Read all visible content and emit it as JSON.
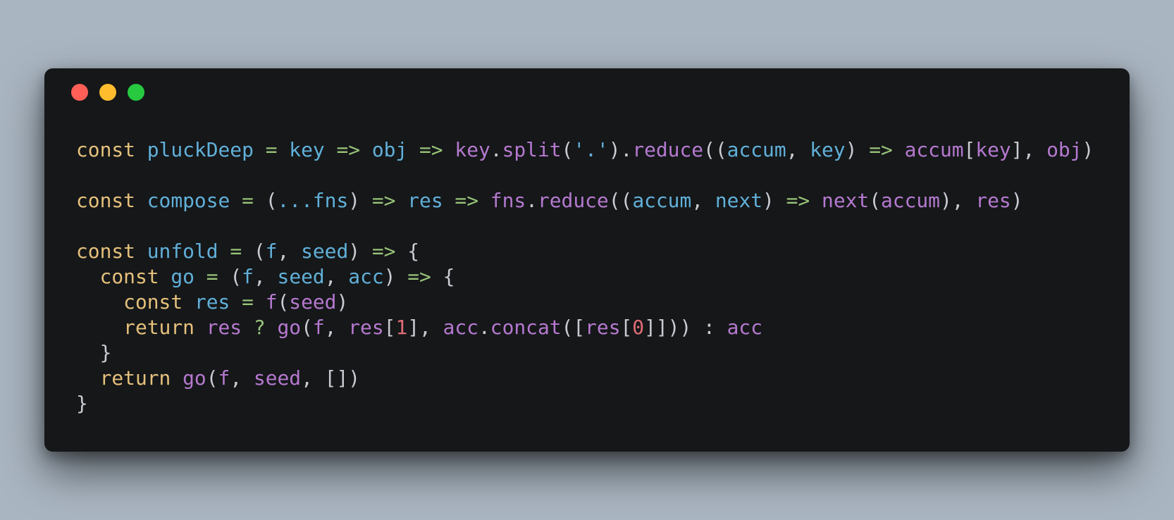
{
  "window": {
    "controls": {
      "close_color": "#ff5f56",
      "minimize_color": "#ffbd2e",
      "maximize_color": "#27c93f"
    },
    "colors": {
      "background": "#a9b5c1",
      "editor": "#151719",
      "keyword": "#e5c07b",
      "identifier": "#61b0d9",
      "call": "#b579cf",
      "operator": "#98c379",
      "punctuation": "#c8ccd2",
      "number": "#e06c75"
    }
  },
  "code": {
    "lines": [
      [
        [
          "k",
          "const"
        ],
        [
          "w",
          " "
        ],
        [
          "b",
          "pluckDeep"
        ],
        [
          "w",
          " "
        ],
        [
          "g",
          "="
        ],
        [
          "w",
          " "
        ],
        [
          "b",
          "key"
        ],
        [
          "w",
          " "
        ],
        [
          "g",
          "=>"
        ],
        [
          "w",
          " "
        ],
        [
          "b",
          "obj"
        ],
        [
          "w",
          " "
        ],
        [
          "g",
          "=>"
        ],
        [
          "w",
          " "
        ],
        [
          "p",
          "key"
        ],
        [
          "w",
          "."
        ],
        [
          "p",
          "split"
        ],
        [
          "w",
          "("
        ],
        [
          "b",
          "'.'"
        ],
        [
          "w",
          ")."
        ],
        [
          "p",
          "reduce"
        ],
        [
          "w",
          "(("
        ],
        [
          "b",
          "accum"
        ],
        [
          "w",
          ", "
        ],
        [
          "b",
          "key"
        ],
        [
          "w",
          ") "
        ],
        [
          "g",
          "=>"
        ],
        [
          "w",
          " "
        ],
        [
          "p",
          "accum"
        ],
        [
          "w",
          "["
        ],
        [
          "p",
          "key"
        ],
        [
          "w",
          "], "
        ],
        [
          "p",
          "obj"
        ],
        [
          "w",
          ")"
        ]
      ],
      [],
      [
        [
          "k",
          "const"
        ],
        [
          "w",
          " "
        ],
        [
          "b",
          "compose"
        ],
        [
          "w",
          " "
        ],
        [
          "g",
          "="
        ],
        [
          "w",
          " ("
        ],
        [
          "b",
          "...fns"
        ],
        [
          "w",
          ") "
        ],
        [
          "g",
          "=>"
        ],
        [
          "w",
          " "
        ],
        [
          "b",
          "res"
        ],
        [
          "w",
          " "
        ],
        [
          "g",
          "=>"
        ],
        [
          "w",
          " "
        ],
        [
          "p",
          "fns"
        ],
        [
          "w",
          "."
        ],
        [
          "p",
          "reduce"
        ],
        [
          "w",
          "(("
        ],
        [
          "b",
          "accum"
        ],
        [
          "w",
          ", "
        ],
        [
          "b",
          "next"
        ],
        [
          "w",
          ") "
        ],
        [
          "g",
          "=>"
        ],
        [
          "w",
          " "
        ],
        [
          "p",
          "next"
        ],
        [
          "w",
          "("
        ],
        [
          "p",
          "accum"
        ],
        [
          "w",
          "), "
        ],
        [
          "p",
          "res"
        ],
        [
          "w",
          ")"
        ]
      ],
      [],
      [
        [
          "k",
          "const"
        ],
        [
          "w",
          " "
        ],
        [
          "b",
          "unfold"
        ],
        [
          "w",
          " "
        ],
        [
          "g",
          "="
        ],
        [
          "w",
          " ("
        ],
        [
          "b",
          "f"
        ],
        [
          "w",
          ", "
        ],
        [
          "b",
          "seed"
        ],
        [
          "w",
          ") "
        ],
        [
          "g",
          "=>"
        ],
        [
          "w",
          " {"
        ]
      ],
      [
        [
          "w",
          "  "
        ],
        [
          "k",
          "const"
        ],
        [
          "w",
          " "
        ],
        [
          "b",
          "go"
        ],
        [
          "w",
          " "
        ],
        [
          "g",
          "="
        ],
        [
          "w",
          " ("
        ],
        [
          "b",
          "f"
        ],
        [
          "w",
          ", "
        ],
        [
          "b",
          "seed"
        ],
        [
          "w",
          ", "
        ],
        [
          "b",
          "acc"
        ],
        [
          "w",
          ") "
        ],
        [
          "g",
          "=>"
        ],
        [
          "w",
          " {"
        ]
      ],
      [
        [
          "w",
          "    "
        ],
        [
          "k",
          "const"
        ],
        [
          "w",
          " "
        ],
        [
          "b",
          "res"
        ],
        [
          "w",
          " "
        ],
        [
          "g",
          "="
        ],
        [
          "w",
          " "
        ],
        [
          "p",
          "f"
        ],
        [
          "w",
          "("
        ],
        [
          "p",
          "seed"
        ],
        [
          "w",
          ")"
        ]
      ],
      [
        [
          "w",
          "    "
        ],
        [
          "k",
          "return"
        ],
        [
          "w",
          " "
        ],
        [
          "p",
          "res"
        ],
        [
          "w",
          " "
        ],
        [
          "g",
          "?"
        ],
        [
          "w",
          " "
        ],
        [
          "p",
          "go"
        ],
        [
          "w",
          "("
        ],
        [
          "p",
          "f"
        ],
        [
          "w",
          ", "
        ],
        [
          "p",
          "res"
        ],
        [
          "w",
          "["
        ],
        [
          "r",
          "1"
        ],
        [
          "w",
          "], "
        ],
        [
          "p",
          "acc"
        ],
        [
          "w",
          "."
        ],
        [
          "p",
          "concat"
        ],
        [
          "w",
          "(["
        ],
        [
          "p",
          "res"
        ],
        [
          "w",
          "["
        ],
        [
          "r",
          "0"
        ],
        [
          "w",
          "]])) : "
        ],
        [
          "p",
          "acc"
        ]
      ],
      [
        [
          "w",
          "  }"
        ]
      ],
      [
        [
          "w",
          "  "
        ],
        [
          "k",
          "return"
        ],
        [
          "w",
          " "
        ],
        [
          "p",
          "go"
        ],
        [
          "w",
          "("
        ],
        [
          "p",
          "f"
        ],
        [
          "w",
          ", "
        ],
        [
          "p",
          "seed"
        ],
        [
          "w",
          ", [])"
        ]
      ],
      [
        [
          "w",
          "}"
        ]
      ]
    ]
  }
}
